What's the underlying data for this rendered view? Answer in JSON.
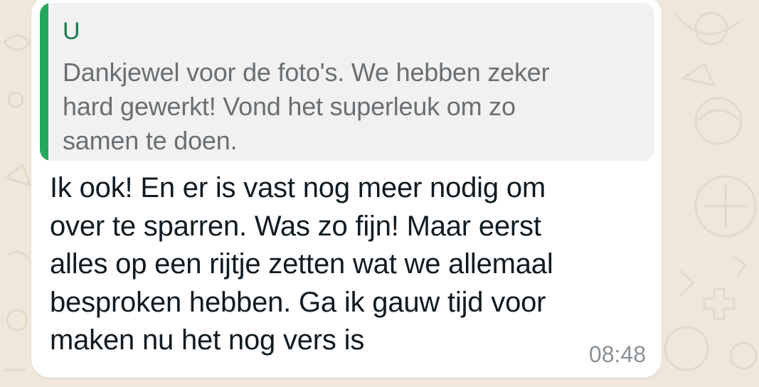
{
  "theme": {
    "background": "#efe7dc",
    "bubble_background": "#ffffff",
    "quote_background": "#f1f1f1",
    "quote_bar_color": "#25a85c",
    "quote_author_color": "#1b7a4a",
    "text_color": "#111b21",
    "muted_text_color": "#6a6f73"
  },
  "message": {
    "quoted": {
      "author": "U",
      "lines": [
        "Dankjewel voor de foto's. We hebben zeker",
        "hard gewerkt! Vond het superleuk om zo",
        "samen te doen."
      ]
    },
    "lines": [
      "Ik ook! En er is vast nog meer nodig om",
      "over te sparren. Was zo fijn! Maar eerst",
      "alles op een rijtje zetten wat we allemaal",
      "besproken hebben. Ga ik gauw tijd voor",
      "maken nu het nog vers is"
    ],
    "time": "08:48"
  }
}
